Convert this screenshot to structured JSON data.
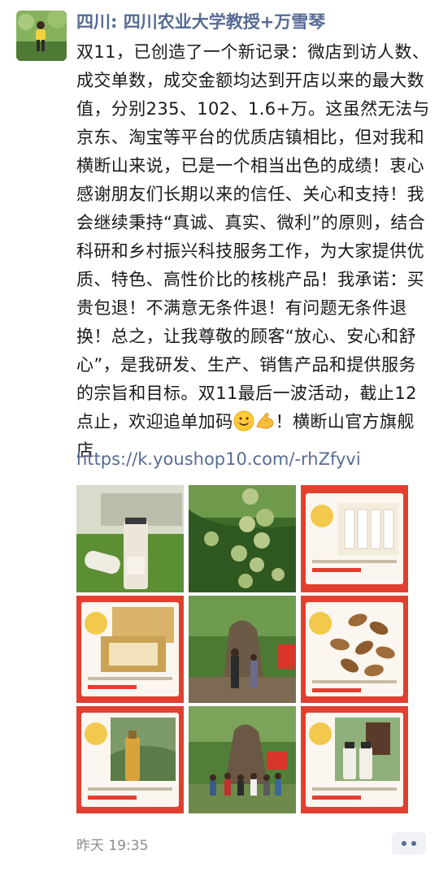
{
  "post": {
    "author": "四川: 四川农业大学教授+万雪琴",
    "text_part1": "双11，已创造了一个新记录：微店到访人数、成交单数，成交金额均达到开店以来的最大数值，分别235、102、1.6+万。这虽然无法与京东、淘宝等平台的优质店镇相比，但对我和横断山来说，已是一个相当出色的成绩！衷心感谢朋友们长期以来的信任、关心和支持！我会继续秉持“真诚、真实、微利”的原则，结合科研和乡村振兴科技服务工作，为大家提供优质、特色、高性价比的核桃产品！我承诺：买贵包退！不满意无条件退！有问题无条件退换！总之，让我尊敬的顾客“放心、安心和舒心”，是我研发、生产、销售产品和提供服务的宗旨和目标。双11最后一波活动，截止12点止，欢迎追单加码",
    "text_part2": "！横断山官方旗舰店",
    "emoji_1": "smiling-face-icon",
    "emoji_2": "flexed-biceps-icon",
    "link": "https://k.youshop10.com/-rhZfyvi",
    "timestamp": "昨天 19:35",
    "photos": [
      "walnut-oil-bottle-on-grass",
      "green-walnuts-on-tree",
      "walnut-box-promo-card",
      "walnut-gift-box-promo-card",
      "ancient-walnut-tree-with-people",
      "cracked-walnuts-promo-card",
      "walnut-oil-bottle-promo-card",
      "group-photo-under-walnut-tree",
      "walnut-oil-set-promo-card"
    ]
  },
  "colors": {
    "author": "#576b95",
    "link": "#576b95",
    "text": "#1a1a1a",
    "time": "#8c8c8c",
    "promo_red": "#e63f33"
  }
}
